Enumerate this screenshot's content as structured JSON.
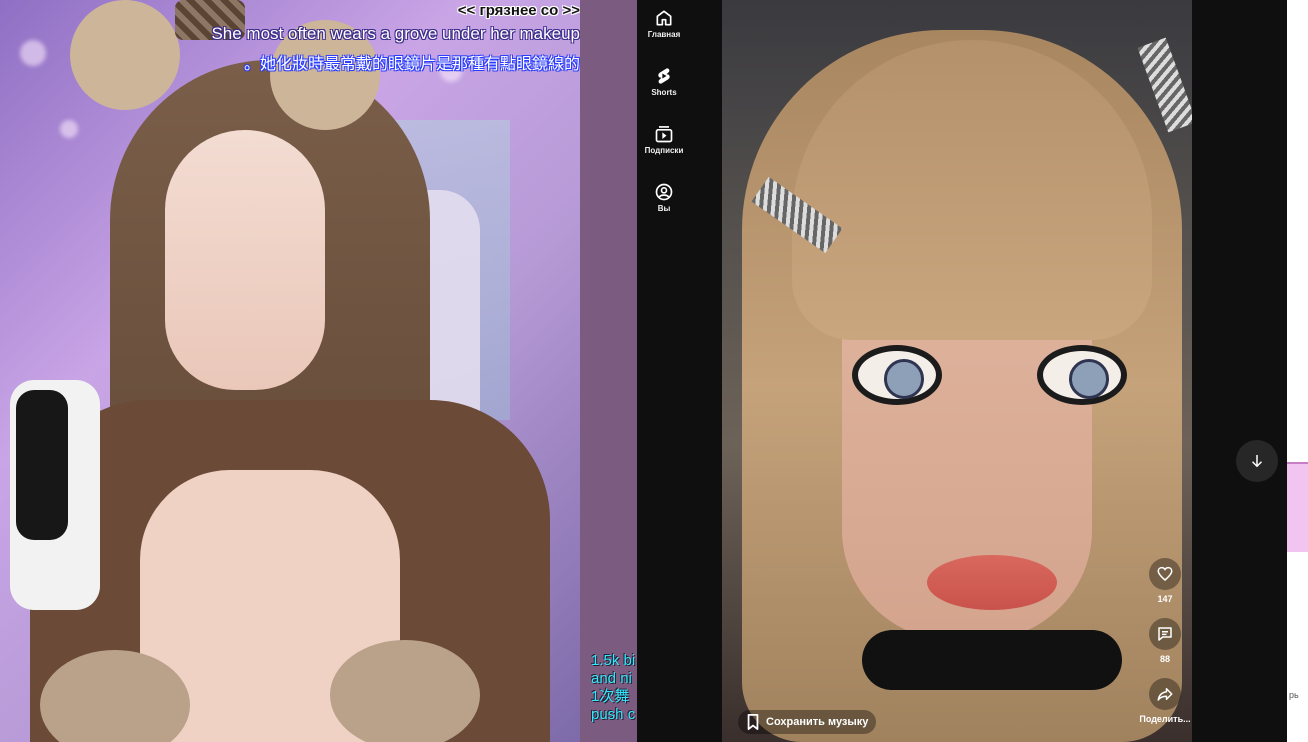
{
  "stream": {
    "caption_ru": "<< грязнее со >>",
    "caption_en": "She most often wears a grove under her makeup",
    "caption_zh": "。她化妝時最常戴的眼鏡片是那種有點眼鏡線的",
    "side_text": [
      "1.5k bi",
      "and ni",
      "1次舞",
      "push c"
    ]
  },
  "youtube": {
    "sidebar": [
      {
        "label": "Главная",
        "icon": "home-icon"
      },
      {
        "label": "Shorts",
        "icon": "shorts-icon"
      },
      {
        "label": "Подписки",
        "icon": "subscriptions-icon"
      },
      {
        "label": "Вы",
        "icon": "account-icon"
      }
    ],
    "actions": {
      "likes": "147",
      "comments": "88",
      "share_label": "Поделить..."
    },
    "save_music_label": "Сохранить музыку"
  },
  "right_edge": {
    "tiny_text": "рь"
  },
  "colors": {
    "yt_bg": "#0f0f0f",
    "gap_purple": "#7c5b80",
    "caption_cyan": "#35e8ff"
  }
}
